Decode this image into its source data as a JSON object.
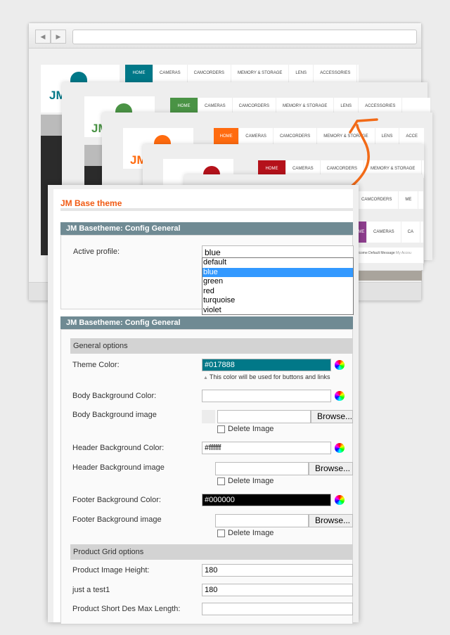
{
  "stores": [
    {
      "theme": "blue",
      "color": "#017888",
      "logo": "JM",
      "nav": [
        "HOME",
        "CAMERAS",
        "CAMCORDERS",
        "MEMORY & STORAGE",
        "LENS",
        "ACCESSORIES"
      ]
    },
    {
      "theme": "green",
      "color": "#4a9345",
      "logo": "JM",
      "nav": [
        "HOME",
        "CAMERAS",
        "CAMCORDERS",
        "MEMORY & STORAGE",
        "LENS",
        "ACCESSORIES"
      ]
    },
    {
      "theme": "orange",
      "color": "#ff6b0f",
      "logo": "JM",
      "nav": [
        "HOME",
        "CAMERAS",
        "CAMCORDERS",
        "MEMORY & STORAGE",
        "LENS",
        "ACCE"
      ]
    },
    {
      "theme": "red",
      "color": "#b5121b",
      "nav": [
        "HOME",
        "CAMERAS",
        "CAMCORDERS",
        "MEMORY & STORAGE"
      ]
    },
    {
      "theme": "violet",
      "color": "#8e3e8e",
      "nav": [
        "CAMCORDERS",
        "ME"
      ],
      "nav2": [
        "OME",
        "CAMERAS",
        "CA"
      ],
      "welcome": "Welcome Default Message",
      "account": "My Accou"
    }
  ],
  "panel": {
    "title": "JM Base theme",
    "section1": "JM Basetheme: Config General",
    "active_profile_label": "Active profile:",
    "active_profile_value": "blue",
    "profile_options": [
      "default",
      "blue",
      "green",
      "red",
      "turquoise",
      "violet"
    ],
    "section2": "JM Basetheme: Config General",
    "general_options": "General options",
    "theme_color_label": "Theme Color:",
    "theme_color_value": "#017888",
    "theme_color_hint": "This color will be used for buttons and links",
    "body_bg_color_label": "Body Background Color:",
    "body_bg_image_label": "Body Background image",
    "header_bg_color_label": "Header Background Color:",
    "header_bg_color_value": "#ffffff",
    "header_bg_image_label": "Header Background image",
    "footer_bg_color_label": "Footer Background Color:",
    "footer_bg_color_value": "#000000",
    "footer_bg_image_label": "Footer Background image",
    "browse": "Browse...",
    "delete_image": "Delete Image",
    "product_grid": "Product Grid options",
    "product_image_height_label": "Product Image Height:",
    "product_image_height_value": "180",
    "test_label": "just a test1",
    "test_value": "180",
    "short_des_label": "Product Short Des Max Length:"
  }
}
